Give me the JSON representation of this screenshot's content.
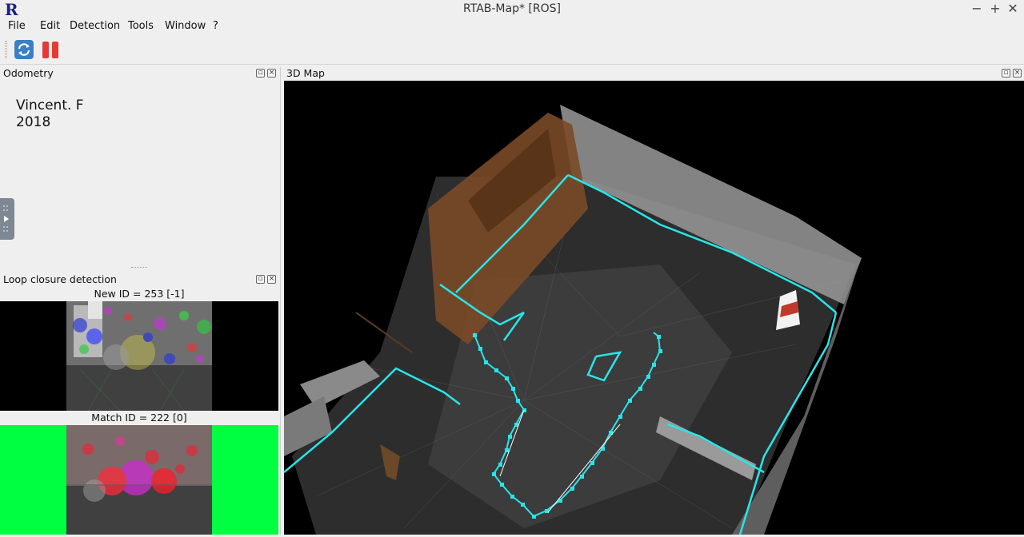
{
  "window": {
    "logo": "R",
    "title": "RTAB-Map* [ROS]",
    "controls": {
      "minimize": "−",
      "maximize": "+",
      "close": "✕"
    }
  },
  "menu": [
    "File",
    "Edit",
    "Detection",
    "Tools",
    "Window",
    "?"
  ],
  "toolbar": {
    "buttons": [
      "refresh-icon",
      "pause-icon"
    ]
  },
  "odometry": {
    "title": "Odometry",
    "text_line1": "Vincent. F",
    "text_line2": "2018"
  },
  "loop_closure": {
    "title": "Loop closure detection",
    "new_label": "New ID = 253 [-1]",
    "match_label": "Match ID = 222 [0]"
  },
  "map": {
    "title": "3D Map"
  },
  "colors": {
    "trajectory": "#27e6ea",
    "match_bg": "#00ff41",
    "map_bg": "#000000",
    "wall": "#9a9a9a",
    "wood": "#7a4a28"
  }
}
